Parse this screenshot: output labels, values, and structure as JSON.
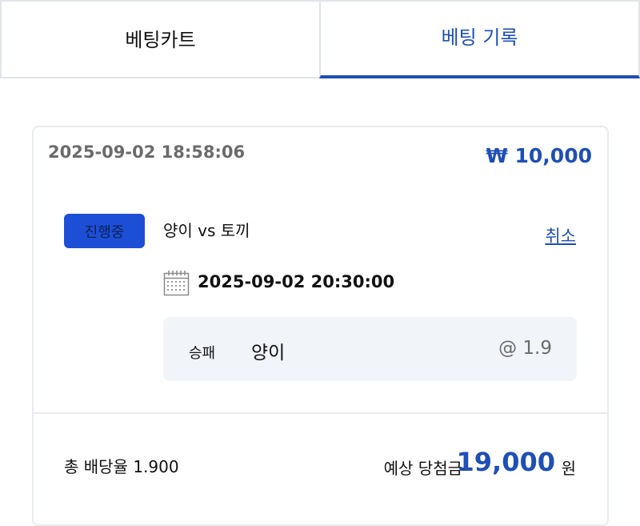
{
  "tabs": {
    "cart_label": "베팅카트",
    "history_label": "베팅 기록",
    "active": "history"
  },
  "bet": {
    "placed_at": "2025-09-02 18:58:06",
    "stake": "₩ 10,000",
    "status": "진행중",
    "match": "양이 vs 토끼",
    "cancel_label": "취소",
    "match_datetime": "2025-09-02 20:30:00",
    "pick": {
      "market": "승패",
      "selection": "양이",
      "odds": "@ 1.9"
    },
    "total_odds": "총 배당율 1.900",
    "expected_label": "예상 당첨금",
    "expected_amount": "19,000",
    "expected_unit": "원"
  },
  "icons": {
    "calendar": "calendar-icon"
  },
  "colors": {
    "accent": "#1f4fb4",
    "badge": "#1d4fd6",
    "pick_background": "#f1f4f9",
    "muted_text": "#6b6b6b"
  }
}
